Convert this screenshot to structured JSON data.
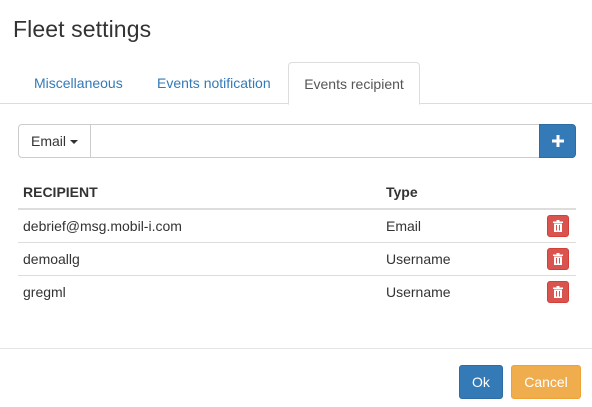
{
  "dialog": {
    "title": "Fleet settings"
  },
  "tabs": [
    {
      "label": "Miscellaneous",
      "active": false
    },
    {
      "label": "Events notification",
      "active": false
    },
    {
      "label": "Events recipient",
      "active": true
    }
  ],
  "add_form": {
    "type_selected": "Email",
    "input_value": "",
    "input_placeholder": "",
    "add_icon": "plus-icon"
  },
  "table": {
    "headers": [
      "RECIPIENT",
      "Type"
    ],
    "rows": [
      {
        "recipient": "debrief@msg.mobil-i.com",
        "type": "Email",
        "action_icon": "trash-icon"
      },
      {
        "recipient": "demoallg",
        "type": "Username",
        "action_icon": "trash-icon"
      },
      {
        "recipient": "gregml",
        "type": "Username",
        "action_icon": "trash-icon"
      }
    ]
  },
  "footer": {
    "ok_label": "Ok",
    "cancel_label": "Cancel"
  },
  "colors": {
    "primary": "#337ab7",
    "danger": "#d9534f",
    "warning": "#f0ad4e",
    "link": "#337ab7"
  }
}
